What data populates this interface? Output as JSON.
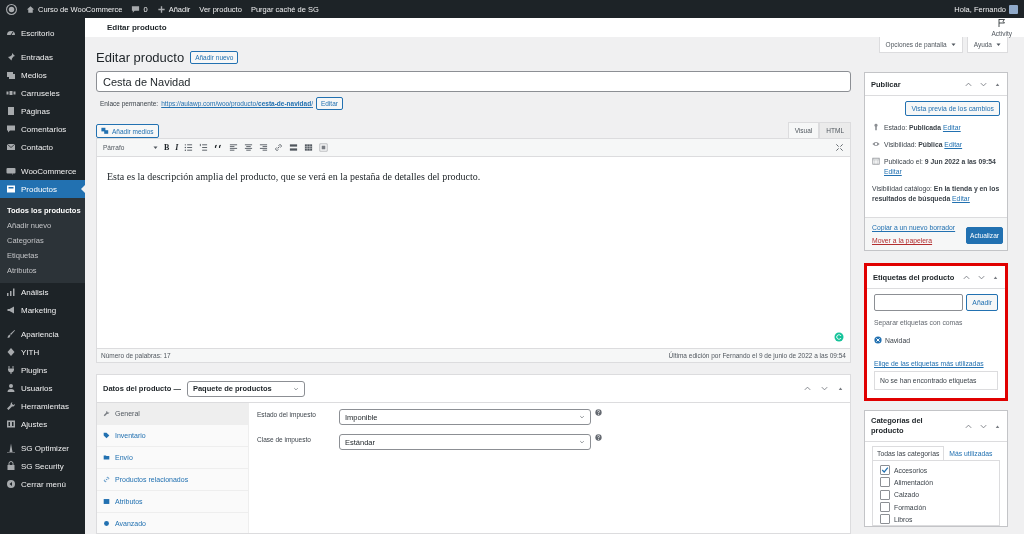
{
  "admin_bar": {
    "site": "Curso de WooCommerce",
    "comments": "0",
    "new": "Añadir",
    "links": [
      "Ver producto",
      "Purgar caché de SG"
    ],
    "greeting": "Hola, Fernando"
  },
  "menu": {
    "groups": [
      [
        {
          "label": "Escritorio",
          "selected": false
        }
      ],
      [
        {
          "label": "Entradas",
          "selected": false
        },
        {
          "label": "Medios",
          "selected": false
        },
        {
          "label": "Carruseles",
          "selected": false
        },
        {
          "label": "Páginas",
          "selected": false
        },
        {
          "label": "Comentarios",
          "selected": false
        },
        {
          "label": "Contacto",
          "selected": false
        }
      ],
      [
        {
          "label": "WooCommerce",
          "selected": false
        },
        {
          "label": "Productos",
          "selected": true,
          "children": [
            {
              "label": "Todos los productos",
              "selected": true
            },
            {
              "label": "Añadir nuevo",
              "selected": false
            },
            {
              "label": "Categorías",
              "selected": false
            },
            {
              "label": "Etiquetas",
              "selected": false
            },
            {
              "label": "Atributos",
              "selected": false
            }
          ]
        },
        {
          "label": "Análisis",
          "selected": false
        },
        {
          "label": "Marketing",
          "selected": false
        }
      ],
      [
        {
          "label": "Apariencia",
          "selected": false
        },
        {
          "label": "YITH",
          "selected": false
        },
        {
          "label": "Plugins",
          "selected": false
        },
        {
          "label": "Usuarios",
          "selected": false
        },
        {
          "label": "Herramientas",
          "selected": false
        },
        {
          "label": "Ajustes",
          "selected": false
        }
      ],
      [
        {
          "label": "SG Optimizer",
          "selected": false
        },
        {
          "label": "SG Security",
          "selected": false
        },
        {
          "label": "Cerrar menú",
          "selected": false
        }
      ]
    ]
  },
  "header": {
    "title": "Editar producto",
    "activity": "Activity"
  },
  "screen_buttons": [
    "Opciones de pantalla",
    "Ayuda"
  ],
  "editor": {
    "heading": "Editar producto",
    "add_new": "Añadir nuevo",
    "title": "Cesta de Navidad",
    "permalink_label": "Enlace permanente:",
    "permalink_url": "https://aulawp.com/woo/producto/**cesta-de-navidad**/",
    "permalink_edit": "Editar",
    "add_media": "Añadir medios",
    "modes": [
      {
        "label": "Visual",
        "selected": true
      },
      {
        "label": "HTML",
        "selected": false
      }
    ],
    "format": "Párrafo",
    "bold": "B",
    "italic": "I",
    "content": "Esta es la descripción amplia del producto, que se verá en la pestaña de detalles del producto.",
    "word_count": "Número de palabras: 17",
    "last_edit": "Última edición por Fernando el 9 de junio de 2022 a las 09:54"
  },
  "product_data": {
    "label": "Datos del producto —",
    "type": "Paquete de productos",
    "tabs": [
      {
        "label": "General",
        "selected": true
      },
      {
        "label": "Inventario",
        "selected": false
      },
      {
        "label": "Envío",
        "selected": false
      },
      {
        "label": "Productos relacionados",
        "selected": false
      },
      {
        "label": "Atributos",
        "selected": false
      },
      {
        "label": "Avanzado",
        "selected": false
      }
    ],
    "fields": [
      {
        "label": "Estado del impuesto",
        "value": "Imponible"
      },
      {
        "label": "Clase de impuesto",
        "value": "Estándar"
      }
    ]
  },
  "publish": {
    "title": "Publicar",
    "preview": "Vista previa de los cambios",
    "rows": [
      {
        "text": "Estado: **Publicada**",
        "link": "Editar"
      },
      {
        "text": "Visibilidad: **Pública**",
        "link": "Editar"
      },
      {
        "text": "Publicado el: **9 Jun 2022 a las 09:54**",
        "link": "Editar"
      },
      {
        "text": "Visibilidad catálogo: **En la tienda y en los resultados de búsqueda**",
        "link": "Editar"
      }
    ],
    "copy": "Copiar a un nuevo borrador",
    "trash": "Mover a la papelera",
    "update": "Actualizar"
  },
  "tags": {
    "title": "Etiquetas del producto",
    "highlighted": true,
    "add": "Añadir",
    "hint": "Separar etiquetas con comas",
    "items": [
      "Navidad"
    ],
    "choose": "Elige de las etiquetas más utilizadas",
    "empty": "No se han encontrado etiquetas"
  },
  "categories": {
    "title": "Categorías del producto",
    "tabs": [
      {
        "label": "Todas las categorías",
        "selected": true
      },
      {
        "label": "Más utilizadas",
        "selected": false
      }
    ],
    "items": [
      {
        "label": "Accesorios",
        "checked": true
      },
      {
        "label": "Alimentación",
        "checked": false
      },
      {
        "label": "Calzado",
        "checked": false
      },
      {
        "label": "Formación",
        "checked": false
      },
      {
        "label": "Libros",
        "checked": false
      }
    ]
  }
}
